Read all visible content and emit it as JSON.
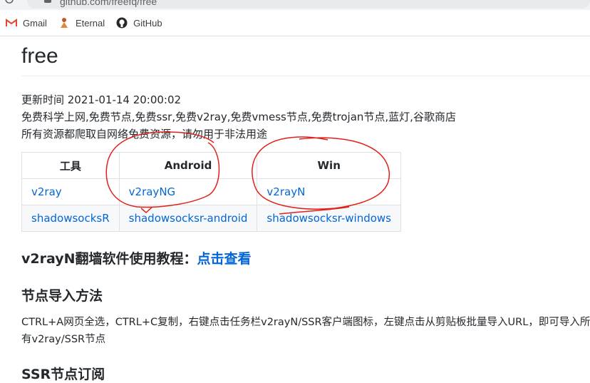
{
  "browser": {
    "url": "github.com/freefq/free",
    "bookmarks": [
      {
        "label": "Gmail",
        "icon": "gmail-icon"
      },
      {
        "label": "Eternal",
        "icon": "eternal-icon"
      },
      {
        "label": "GitHub",
        "icon": "github-icon"
      }
    ]
  },
  "page": {
    "title": "free",
    "updated": "更新时间 2021-01-14 20:00:02",
    "desc1": "免费科学上网,免费节点,免费ssr,免费v2ray,免费vmess节点,免费trojan节点,蓝灯,谷歌商店",
    "desc2": "所有资源都爬取自网络免费资源，请勿用于非法用途",
    "table": {
      "headers": [
        "工具",
        "Android",
        "Win"
      ],
      "rows": [
        [
          "v2ray",
          "v2rayNG",
          "v2rayN"
        ],
        [
          "shadowsocksR",
          "shadowsocksr-android",
          "shadowsocksr-windows"
        ]
      ]
    },
    "tutorial_heading": "v2rayN翻墙软件使用教程：",
    "tutorial_link": "点击查看",
    "import_heading": "节点导入方法",
    "import_text": "CTRL+A网页全选，CTRL+C复制，右键点击任务栏v2rayN/SSR客户端图标，左键点击从剪贴板批量导入URL，即可导入所有v2ray/SSR节点",
    "next_heading": "SSR节点订阅"
  },
  "colors": {
    "link": "#0366d6",
    "annotation": "#e0201a"
  }
}
